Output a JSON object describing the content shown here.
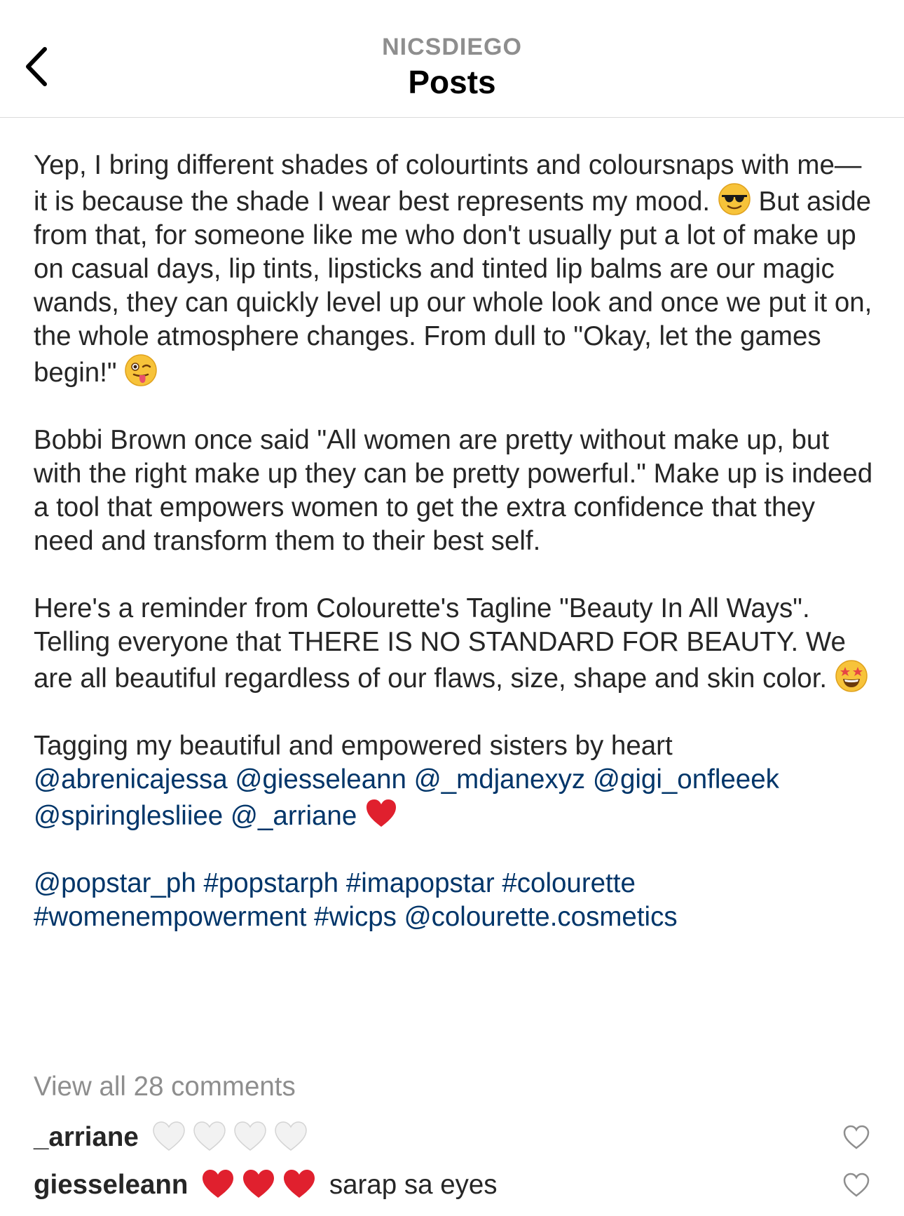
{
  "header": {
    "username": "NICSDIEGO",
    "title": "Posts"
  },
  "caption": {
    "p1_before_emoji": "Yep, I bring different shades of colourtints and coloursnaps with me— it is because the shade I wear best represents my mood. ",
    "p1_emoji1": "sunglasses-face",
    "p1_middle": " But aside from that, for someone like me who don't usually put a lot of make up on casual days, lip tints, lipsticks and tinted lip balms are our magic wands, they can quickly level up our whole look and once we put it on, the whole atmosphere changes. From dull to \"Okay, let the games begin!\" ",
    "p1_emoji2": "winking-tongue-face",
    "p2": "Bobbi Brown once said \"All women are pretty without make up, but with the right make up they can be pretty powerful.\" Make up is indeed a tool that empowers women to get the extra confidence that they need and transform them to their best self.",
    "p3_text": "Here's a reminder from Colourette's Tagline \"Beauty In All Ways\". Telling everyone that THERE IS NO STANDARD FOR BEAUTY. We are all beautiful regardless of our flaws, size, shape and skin color. ",
    "p3_emoji": "star-struck-face",
    "p4_text": "Tagging my beautiful and empowered sisters by heart",
    "p4_mentions": [
      "@abrenicajessa",
      "@giesseleann",
      "@_mdjanexyz",
      "@gigi_onfleeek",
      "@spiringlesliiee",
      "@_arriane"
    ],
    "p4_emoji": "red-heart",
    "p5_tags": [
      "@popstar_ph",
      "#popstarph",
      "#imapopstar",
      "#colourette",
      "#womenempowerment",
      "#wicps",
      "@colourette.cosmetics"
    ]
  },
  "comments_link": "View all 28 comments",
  "comments": [
    {
      "user": "_arriane",
      "hearts": [
        "white-heart",
        "white-heart",
        "white-heart",
        "white-heart"
      ],
      "text": ""
    },
    {
      "user": "giesseleann",
      "hearts": [
        "red-heart",
        "red-heart",
        "red-heart"
      ],
      "text": "sarap sa eyes"
    }
  ],
  "colors": {
    "link": "#003569",
    "muted": "#8e8e8e",
    "text": "#262626"
  }
}
